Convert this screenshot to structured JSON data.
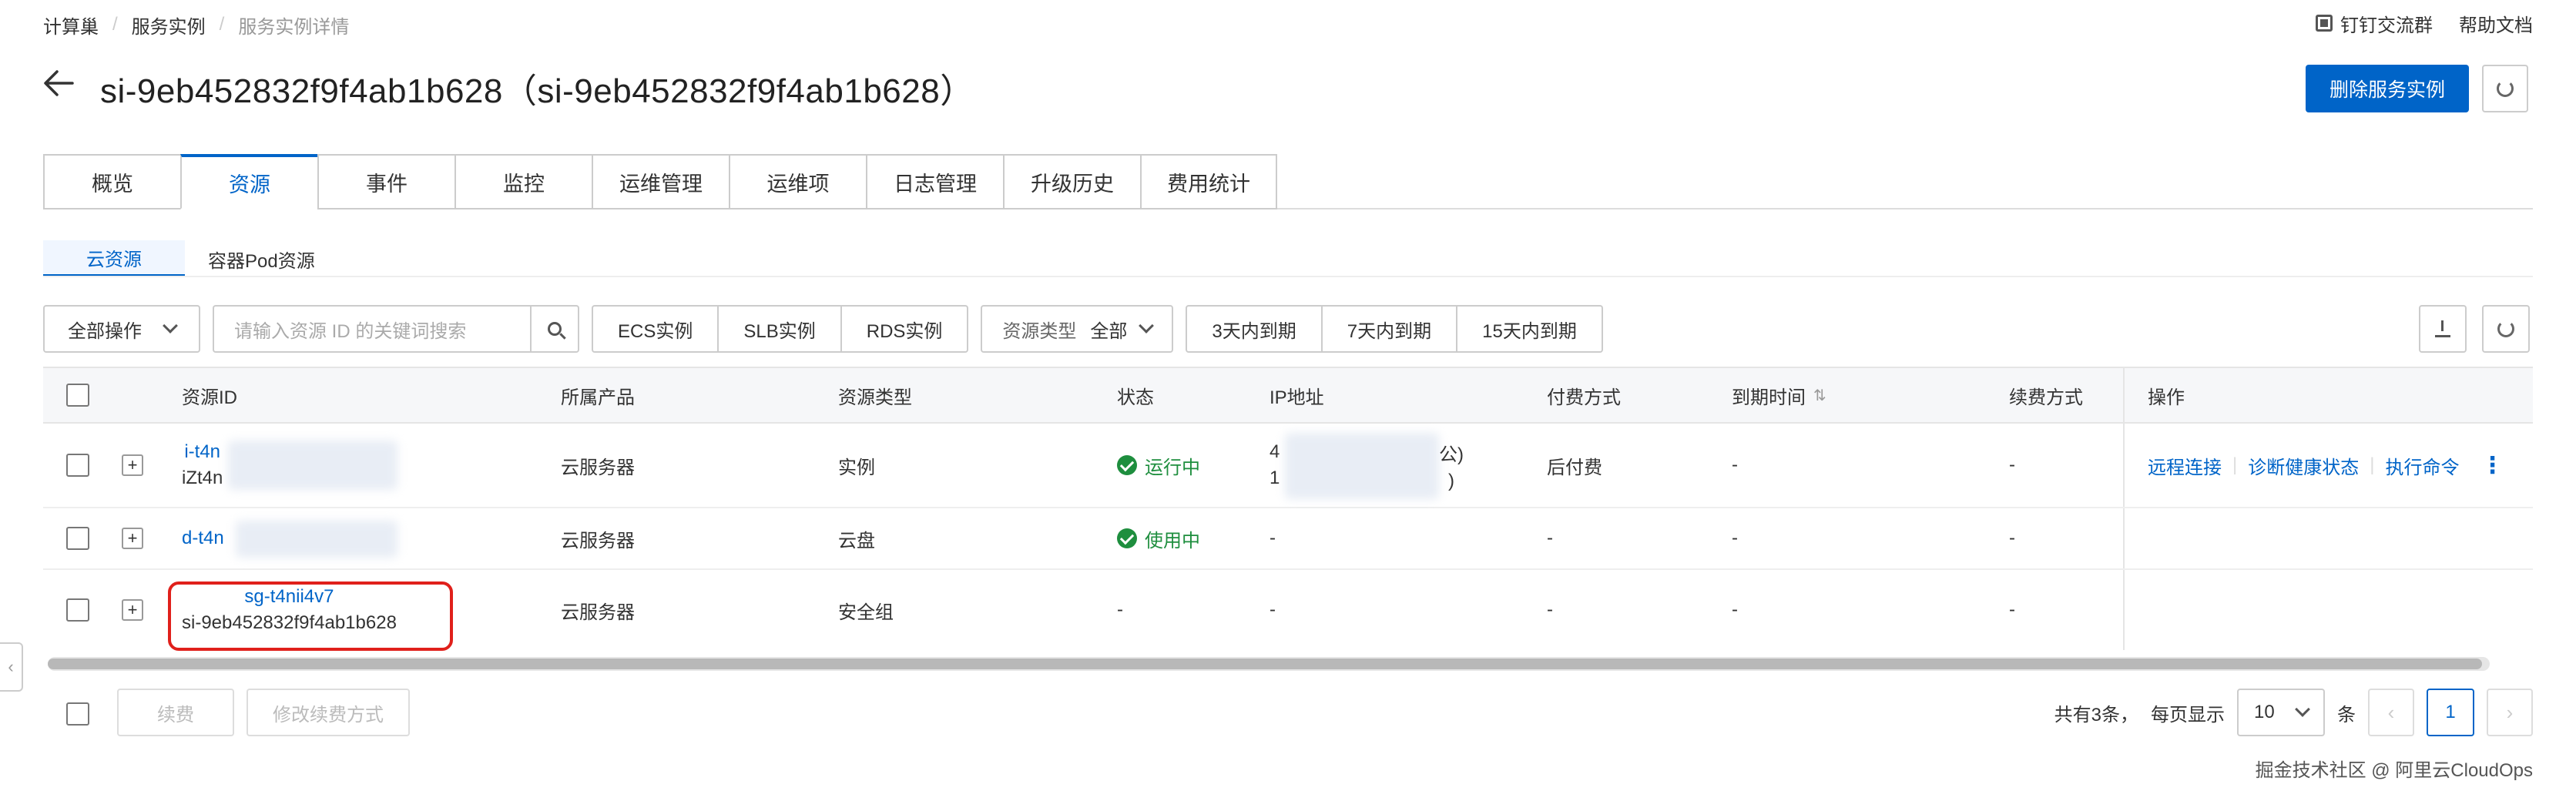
{
  "breadcrumb": [
    "计算巢",
    "服务实例",
    "服务实例详情"
  ],
  "top_links": {
    "dingtalk": "钉钉交流群",
    "help": "帮助文档"
  },
  "header": {
    "title": "si-9eb452832f9f4ab1b628（si-9eb452832f9f4ab1b628）",
    "delete_button": "删除服务实例"
  },
  "main_tabs": [
    {
      "label": "概览"
    },
    {
      "label": "资源",
      "active": true
    },
    {
      "label": "事件"
    },
    {
      "label": "监控"
    },
    {
      "label": "运维管理"
    },
    {
      "label": "运维项"
    },
    {
      "label": "日志管理"
    },
    {
      "label": "升级历史"
    },
    {
      "label": "费用统计"
    }
  ],
  "sub_tabs": [
    {
      "label": "云资源",
      "active": true
    },
    {
      "label": "容器Pod资源"
    }
  ],
  "toolbar": {
    "bulk_action": "全部操作",
    "search_placeholder": "请输入资源 ID 的关键词搜索",
    "filters": [
      "ECS实例",
      "SLB实例",
      "RDS实例"
    ],
    "resource_type_label": "资源类型",
    "resource_type_value": "全部",
    "expiry_filters": [
      "3天内到期",
      "7天内到期",
      "15天内到期"
    ]
  },
  "table": {
    "columns": [
      "资源ID",
      "所属产品",
      "资源类型",
      "状态",
      "IP地址",
      "付费方式",
      "到期时间",
      "续费方式",
      "操作"
    ],
    "rows": [
      {
        "id_line1": "i-t4n",
        "id_line2": "iZt4n",
        "product": "云服务器",
        "type": "实例",
        "status": "运行中",
        "ip_line1": "4",
        "ip_line1_tail": "公)",
        "ip_line2": "1",
        "ip_line2_tail": ")",
        "billing": "后付费",
        "expiry": "-",
        "renewal": "-",
        "actions": [
          "远程连接",
          "诊断健康状态",
          "执行命令"
        ]
      },
      {
        "id_line1": "d-t4n",
        "product": "云服务器",
        "type": "云盘",
        "status": "使用中",
        "ip": "-",
        "billing": "-",
        "expiry": "-",
        "renewal": "-"
      },
      {
        "id_line1": "sg-t4nii4v7",
        "id_line2": "si-9eb452832f9f4ab1b628",
        "product": "云服务器",
        "type": "安全组",
        "status": "-",
        "ip": "-",
        "billing": "-",
        "expiry": "-",
        "renewal": "-"
      }
    ]
  },
  "footer": {
    "renew_button": "续费",
    "change_renewal_button": "修改续费方式",
    "total_text": "共有3条，",
    "per_page_label": "每页显示",
    "per_page_value": "10",
    "per_page_unit": "条",
    "current_page": "1"
  },
  "watermark": "掘金技术社区 @ 阿里云CloudOps",
  "colors": {
    "primary": "#0064c8",
    "success": "#1e8e3e",
    "highlight": "#e0201b"
  }
}
